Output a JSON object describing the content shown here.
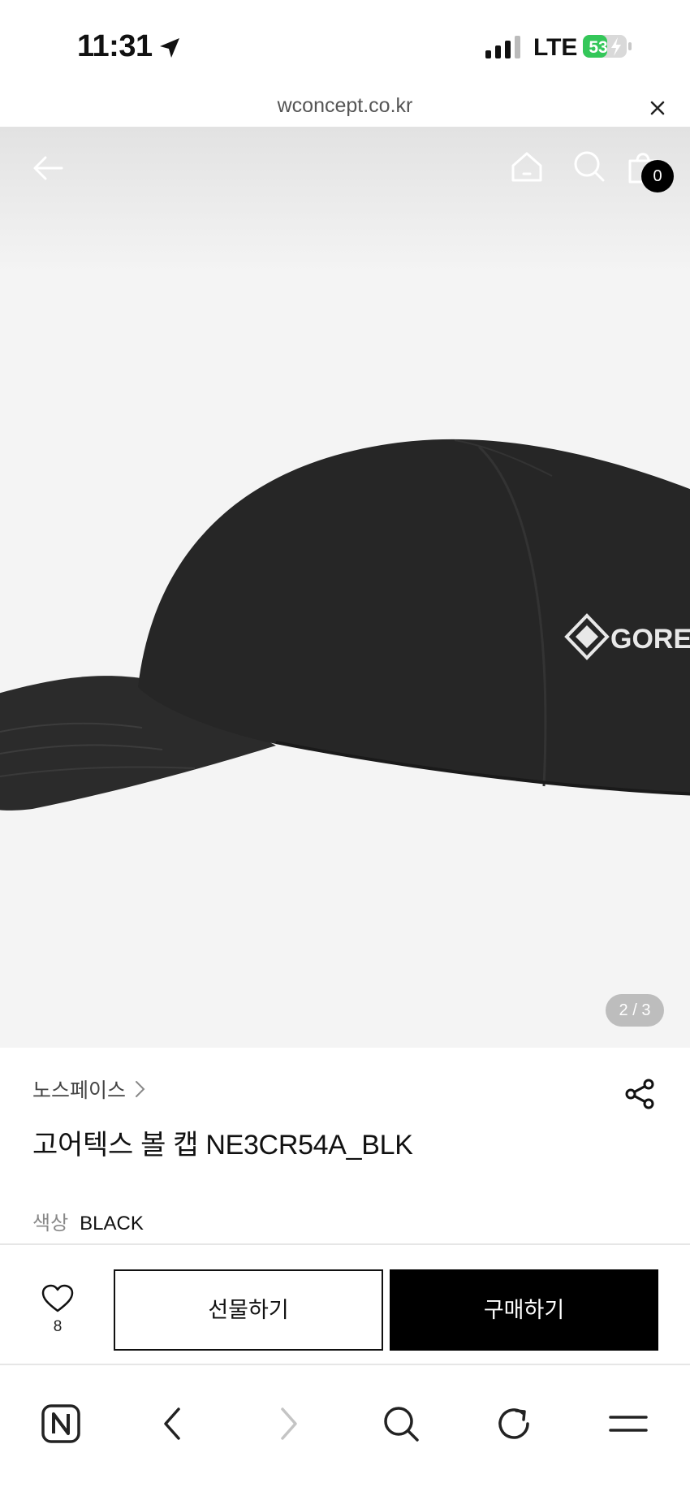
{
  "status_bar": {
    "time": "11:31",
    "network": "LTE",
    "battery": "53"
  },
  "url_bar": {
    "domain": "wconcept.co.kr"
  },
  "header": {
    "cart_count": "0"
  },
  "image": {
    "logo_text": "GORE-TEX",
    "page_indicator": "2 / 3"
  },
  "product": {
    "brand": "노스페이스",
    "title": "고어텍스 볼 캡 NE3CR54A_BLK",
    "color_label": "색상",
    "color_value": "BLACK"
  },
  "actions": {
    "wish_count": "8",
    "gift_label": "선물하기",
    "buy_label": "구매하기"
  },
  "icons": {
    "status": [
      "location-arrow-icon",
      "signal-icon",
      "battery-charging-icon"
    ],
    "header": [
      "back-arrow-icon",
      "home-icon",
      "search-icon",
      "shopping-bag-icon"
    ],
    "info": [
      "chevron-right-icon",
      "share-icon"
    ],
    "action": [
      "heart-icon"
    ],
    "browser": [
      "naver-n-icon",
      "browser-back-icon",
      "browser-forward-icon",
      "browser-search-icon",
      "reload-icon",
      "menu-icon"
    ]
  },
  "colors": {
    "accent": "#000000",
    "battery_green": "#34c759",
    "image_bg": "#f4f4f4"
  }
}
